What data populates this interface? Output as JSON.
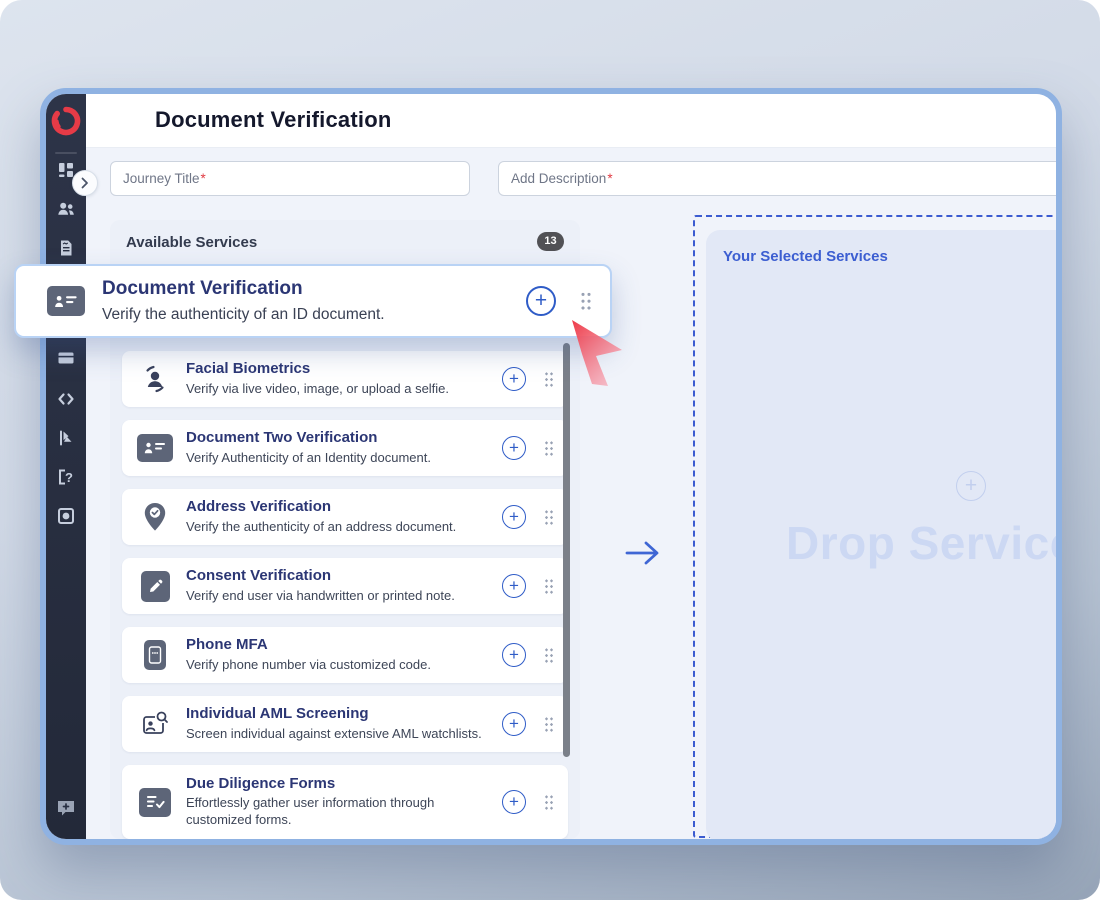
{
  "page": {
    "title": "Document Verification"
  },
  "sidebar": {
    "icons": [
      "brand-logo",
      "dashboard",
      "users",
      "document",
      "panel",
      "code",
      "flag",
      "help",
      "record",
      "new-chat"
    ]
  },
  "form": {
    "journey_title_placeholder": "Journey Title",
    "description_placeholder": "Add Description",
    "required_mark": "*"
  },
  "available_services": {
    "header": "Available Services",
    "count": "13",
    "items": [
      {
        "title": "Facial Biometrics",
        "description": "Verify via live video, image, or upload a selfie."
      },
      {
        "title": "Document Two Verification",
        "description": "Verify Authenticity of an Identity document."
      },
      {
        "title": "Address Verification",
        "description": "Verify the authenticity of an address document."
      },
      {
        "title": "Consent Verification",
        "description": "Verify end user via handwritten or printed note."
      },
      {
        "title": "Phone MFA",
        "description": "Verify phone number via customized code."
      },
      {
        "title": "Individual AML Screening",
        "description": "Screen individual against extensive AML watchlists."
      },
      {
        "title": "Due Diligence Forms",
        "description": "Effortlessly gather user information through customized forms."
      }
    ]
  },
  "dragged_card": {
    "title": "Document Verification",
    "description": "Verify the authenticity of an ID document."
  },
  "selected_services": {
    "header": "Your Selected Services",
    "drop_placeholder": "Drop Services"
  },
  "colors": {
    "accent_blue": "#2f5cc7",
    "brand_red": "#e63b47",
    "sidebar_bg": "#272e42",
    "title_navy": "#2b3674",
    "window_border": "#8fb2e2"
  }
}
